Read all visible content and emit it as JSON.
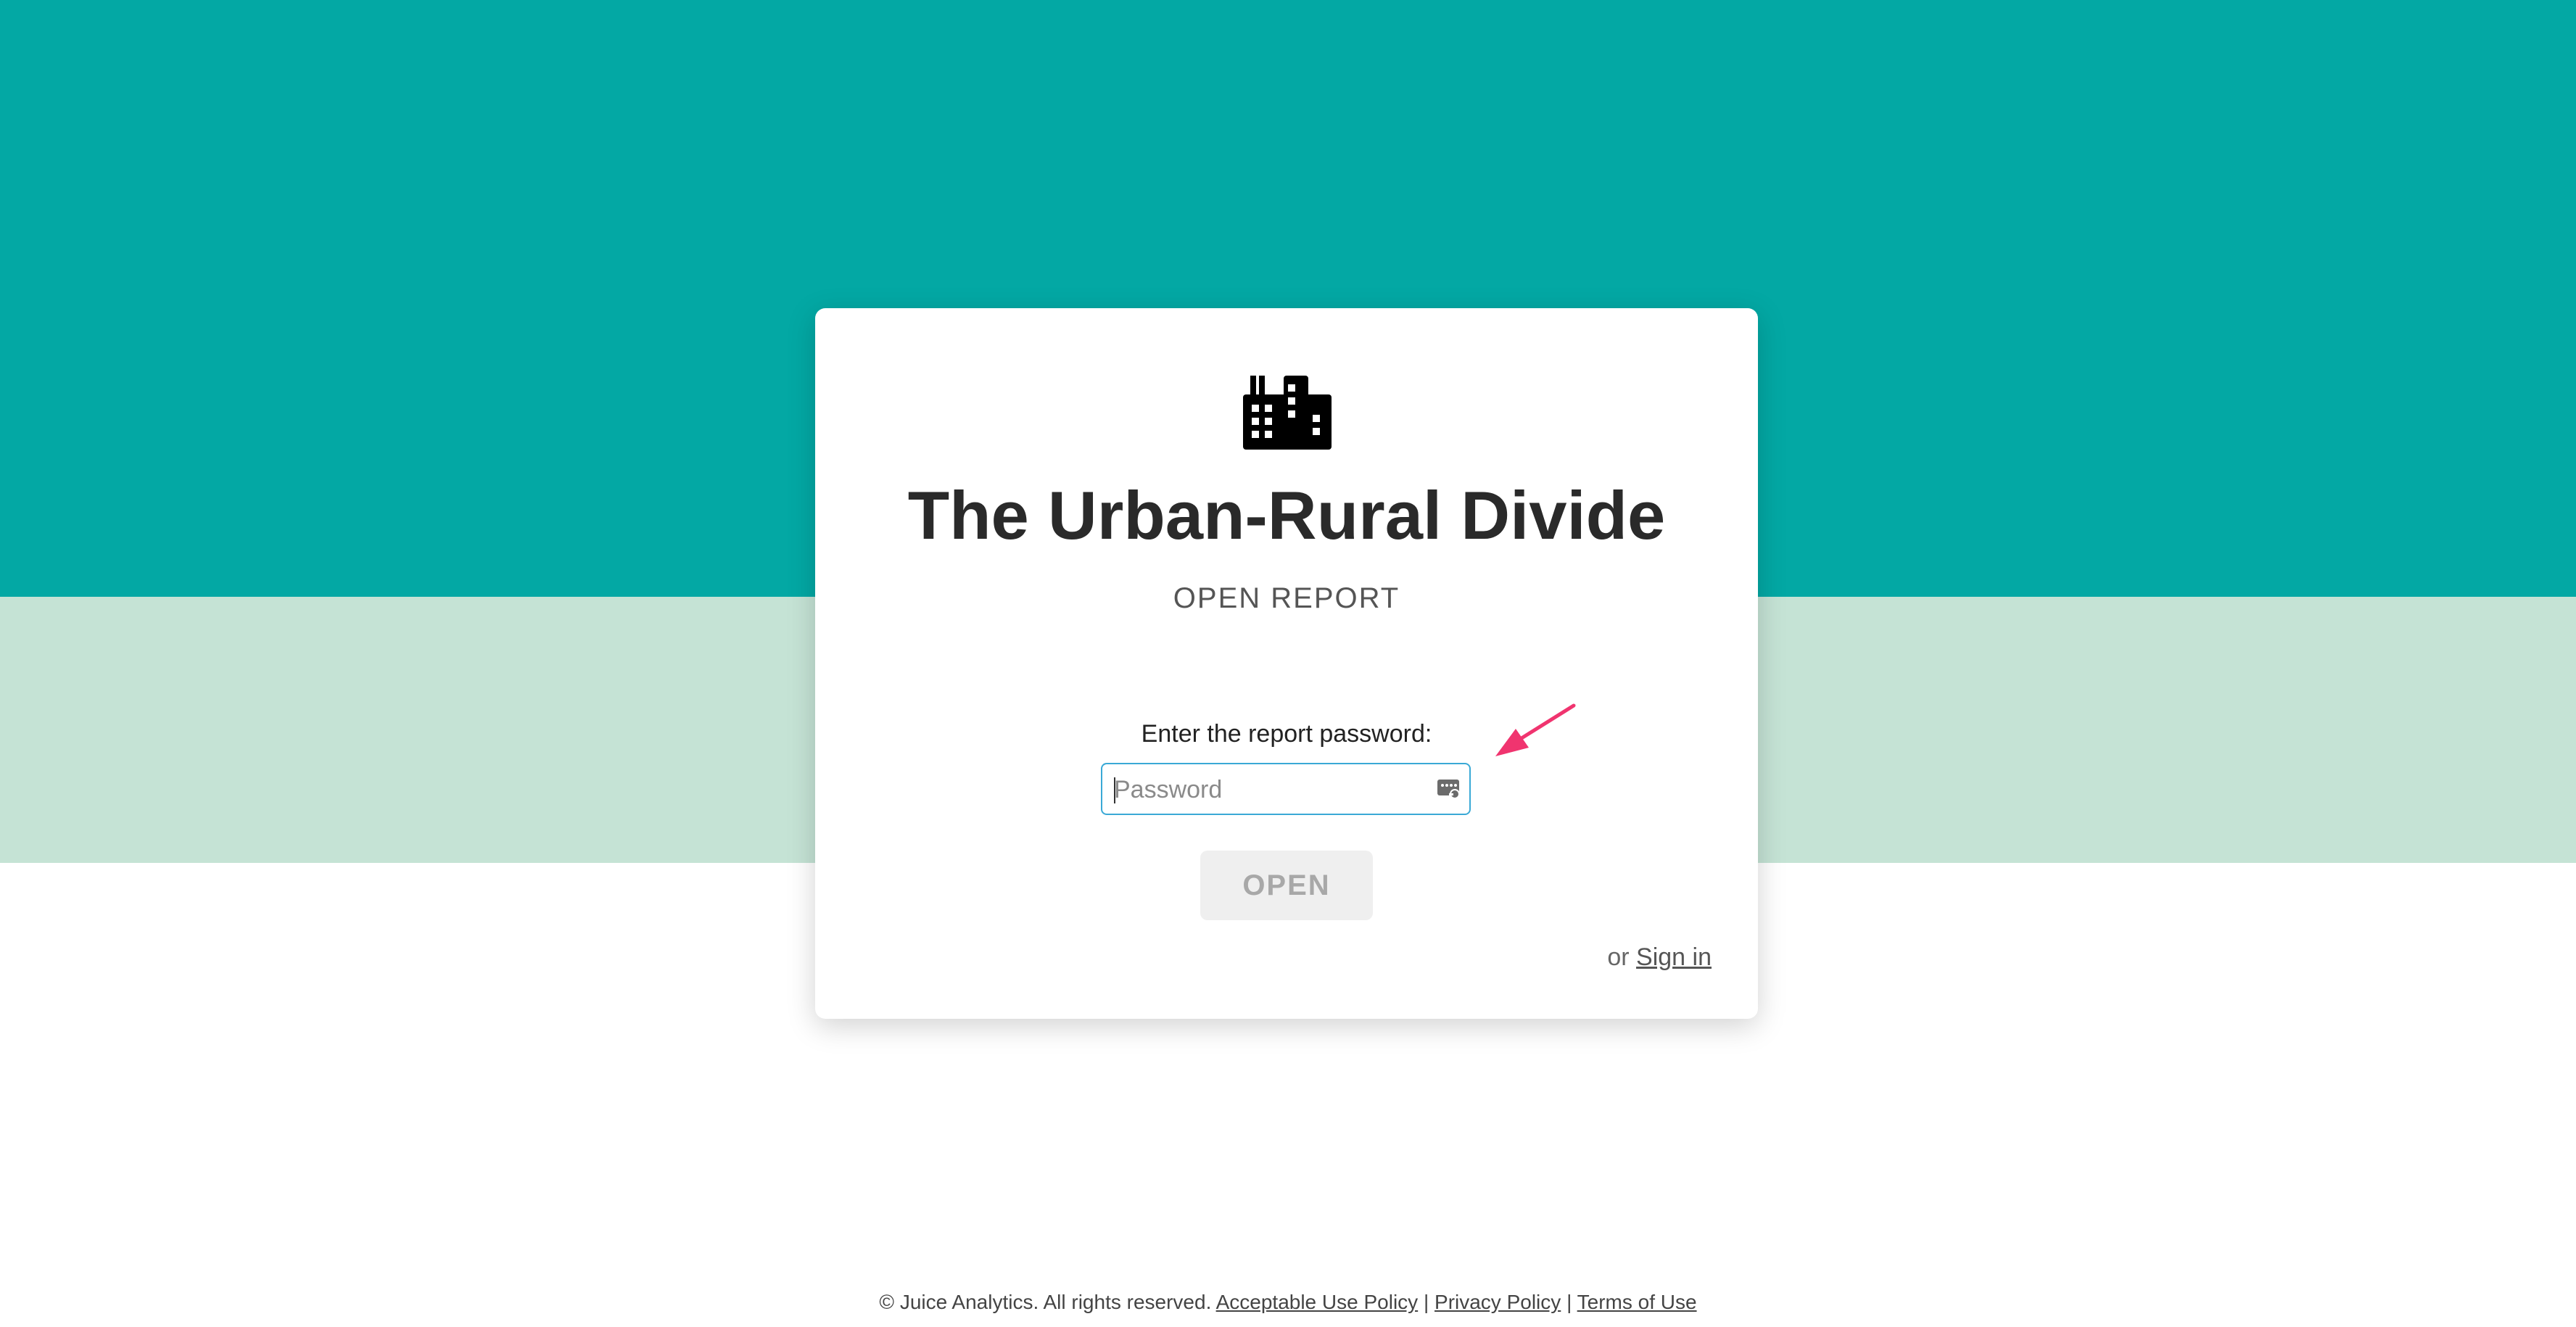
{
  "report": {
    "title": "The Urban-Rural Divide",
    "subtitle": "OPEN REPORT",
    "icon": "city-buildings-icon"
  },
  "password": {
    "label": "Enter the report password:",
    "placeholder": "Password",
    "value": ""
  },
  "actions": {
    "open_label": "OPEN",
    "or_text": "or",
    "signin_label": "Sign in"
  },
  "footer": {
    "copyright": "© Juice Analytics. All rights reserved.",
    "acceptable_use": "Acceptable Use Policy",
    "privacy": "Privacy Policy",
    "terms": "Terms of Use",
    "separator": "|"
  },
  "colors": {
    "header_teal": "#03a8a4",
    "band_mint": "#c5e3d5",
    "arrow_pink": "#f0346f",
    "focus_blue": "#3aa9d6"
  }
}
